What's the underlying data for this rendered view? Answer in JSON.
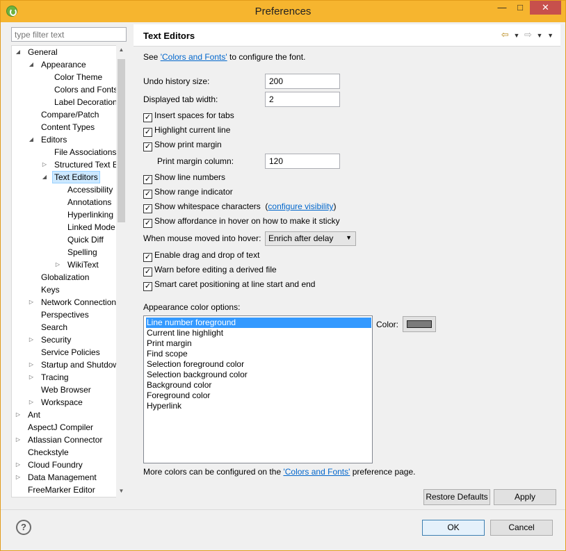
{
  "window": {
    "title": "Preferences",
    "min_glyph": "—",
    "max_glyph": "□",
    "close_glyph": "✕"
  },
  "filter": {
    "placeholder": "type filter text"
  },
  "tree": {
    "expanded_glyph": "◢",
    "collapsed_glyph": "▷",
    "items": [
      {
        "label": "General",
        "level": 0,
        "state": "expanded"
      },
      {
        "label": "Appearance",
        "level": 1,
        "state": "expanded"
      },
      {
        "label": "Color Theme",
        "level": 2,
        "state": "leaf"
      },
      {
        "label": "Colors and Fonts",
        "level": 2,
        "state": "leaf"
      },
      {
        "label": "Label Decorations",
        "level": 2,
        "state": "leaf"
      },
      {
        "label": "Compare/Patch",
        "level": 1,
        "state": "leaf"
      },
      {
        "label": "Content Types",
        "level": 1,
        "state": "leaf"
      },
      {
        "label": "Editors",
        "level": 1,
        "state": "expanded"
      },
      {
        "label": "File Associations",
        "level": 2,
        "state": "leaf"
      },
      {
        "label": "Structured Text Editors",
        "level": 2,
        "state": "collapsed"
      },
      {
        "label": "Text Editors",
        "level": 2,
        "state": "expanded",
        "selected": true
      },
      {
        "label": "Accessibility",
        "level": 3,
        "state": "leaf"
      },
      {
        "label": "Annotations",
        "level": 3,
        "state": "leaf"
      },
      {
        "label": "Hyperlinking",
        "level": 3,
        "state": "leaf"
      },
      {
        "label": "Linked Mode",
        "level": 3,
        "state": "leaf"
      },
      {
        "label": "Quick Diff",
        "level": 3,
        "state": "leaf"
      },
      {
        "label": "Spelling",
        "level": 3,
        "state": "leaf"
      },
      {
        "label": "WikiText",
        "level": 3,
        "state": "collapsed"
      },
      {
        "label": "Globalization",
        "level": 1,
        "state": "leaf"
      },
      {
        "label": "Keys",
        "level": 1,
        "state": "leaf"
      },
      {
        "label": "Network Connections",
        "level": 1,
        "state": "collapsed"
      },
      {
        "label": "Perspectives",
        "level": 1,
        "state": "leaf"
      },
      {
        "label": "Search",
        "level": 1,
        "state": "leaf"
      },
      {
        "label": "Security",
        "level": 1,
        "state": "collapsed"
      },
      {
        "label": "Service Policies",
        "level": 1,
        "state": "leaf"
      },
      {
        "label": "Startup and Shutdown",
        "level": 1,
        "state": "collapsed"
      },
      {
        "label": "Tracing",
        "level": 1,
        "state": "collapsed"
      },
      {
        "label": "Web Browser",
        "level": 1,
        "state": "leaf"
      },
      {
        "label": "Workspace",
        "level": 1,
        "state": "collapsed"
      },
      {
        "label": "Ant",
        "level": 0,
        "state": "collapsed"
      },
      {
        "label": "AspectJ Compiler",
        "level": 0,
        "state": "leaf"
      },
      {
        "label": "Atlassian Connector",
        "level": 0,
        "state": "collapsed"
      },
      {
        "label": "Checkstyle",
        "level": 0,
        "state": "leaf"
      },
      {
        "label": "Cloud Foundry",
        "level": 0,
        "state": "collapsed"
      },
      {
        "label": "Data Management",
        "level": 0,
        "state": "collapsed"
      },
      {
        "label": "FreeMarker Editor",
        "level": 0,
        "state": "leaf"
      }
    ]
  },
  "header": {
    "title": "Text Editors",
    "back_glyph": "⇦",
    "forward_glyph": "⇨",
    "dropdown_glyph": "▼",
    "menu_glyph": "▼"
  },
  "intro": {
    "prefix": "See ",
    "link": "'Colors and Fonts'",
    "suffix": " to configure the font."
  },
  "fields": {
    "undo_label": "Undo history size:",
    "undo_value": "200",
    "tab_label": "Displayed tab width:",
    "tab_value": "2",
    "margin_col_label": "Print margin column:",
    "margin_col_value": "120"
  },
  "check_glyph": "✓",
  "checkboxes": {
    "insert_spaces": "Insert spaces for tabs",
    "highlight_line": "Highlight current line",
    "print_margin": "Show print margin",
    "line_numbers": "Show line numbers",
    "range_indicator": "Show range indicator",
    "whitespace": "Show whitespace characters",
    "whitespace_link_open": "(",
    "whitespace_link": "configure visibility",
    "whitespace_link_close": ")",
    "affordance": "Show affordance in hover on how to make it sticky",
    "drag_drop": "Enable drag and drop of text",
    "warn_derived": "Warn before editing a derived file",
    "smart_caret": "Smart caret positioning at line start and end"
  },
  "hover": {
    "label": "When mouse moved into hover:",
    "value": "Enrich after delay",
    "arrow": "▼"
  },
  "appearance": {
    "label": "Appearance color options:",
    "items": [
      "Line number foreground",
      "Current line highlight",
      "Print margin",
      "Find scope",
      "Selection foreground color",
      "Selection background color",
      "Background color",
      "Foreground color",
      "Hyperlink"
    ],
    "color_label": "Color:",
    "swatch_color": "#7a7a7a"
  },
  "footer_note": {
    "prefix": "More colors can be configured on the ",
    "link": "'Colors and Fonts'",
    "suffix": " preference page."
  },
  "buttons": {
    "restore": "Restore Defaults",
    "apply": "Apply",
    "ok": "OK",
    "cancel": "Cancel",
    "help": "?"
  },
  "scroll": {
    "up": "▲",
    "down": "▼"
  }
}
